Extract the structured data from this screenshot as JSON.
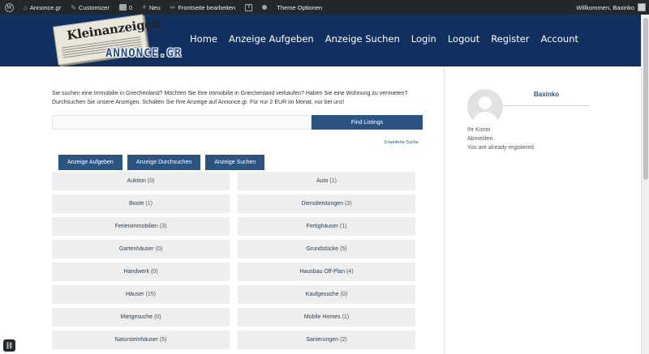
{
  "adminbar": {
    "site": "Annonce.gr",
    "customizer": "Customizer",
    "comments": "0",
    "new": "Neu",
    "edit_front": "Frontseite bearbeiten",
    "theme_options": "Theme Optionen",
    "welcome": "Willkommen, Baxinko"
  },
  "header": {
    "logo_title": "Kleinanzeigen",
    "logo_sub": "ANNONCE.GR",
    "nav": [
      "Home",
      "Anzeige Aufgeben",
      "Anzeige Suchen",
      "Login",
      "Logout",
      "Register",
      "Account"
    ]
  },
  "main": {
    "intro": "Sie suchen eine Immobilie in Griechenland? Möchten Sie Ihre Immobilie in Griechenland verkaufen? Haben Sie eine Wohnung zu vermieten? Durchsuchen Sie unsere Anzeigen. Schalten Sie Ihre Anzeige auf Annonce.gr. Für nur 2 EUR im Monat, nur bei uns!",
    "search_placeholder": "",
    "find_button": "Find Listings",
    "advanced": "Erweiterte Suche",
    "buttons": [
      "Anzeige Aufgeben",
      "Anzeige Durchsuchen",
      "Anzeige Suchen"
    ],
    "categories": [
      {
        "name": "Auktion",
        "count": "(0)"
      },
      {
        "name": "Auto",
        "count": "(1)"
      },
      {
        "name": "Boote",
        "count": "(1)"
      },
      {
        "name": "Dienstleistungen",
        "count": "(3)"
      },
      {
        "name": "Ferienimmobilien",
        "count": "(3)"
      },
      {
        "name": "Fertighäuser",
        "count": "(1)"
      },
      {
        "name": "Gartenhäuser",
        "count": "(0)"
      },
      {
        "name": "Grundstücke",
        "count": "(5)"
      },
      {
        "name": "Handwerk",
        "count": "(0)"
      },
      {
        "name": "Hausbau Off-Plan",
        "count": "(4)"
      },
      {
        "name": "Häuser",
        "count": "(15)"
      },
      {
        "name": "Kaufgesuche",
        "count": "(0)"
      },
      {
        "name": "Mietgesuche",
        "count": "(0)"
      },
      {
        "name": "Mobile Homes",
        "count": "(1)"
      },
      {
        "name": "Natursteinhäuser",
        "count": "(5)"
      },
      {
        "name": "Sanierungen",
        "count": "(2)"
      }
    ]
  },
  "sidebar": {
    "username": "Baxinko",
    "links": [
      "Ihr Konto",
      "Abmelden",
      "You are already registered"
    ]
  },
  "colors": {
    "header_bg": "#11305f",
    "button_bg": "#2c5483",
    "adminbar_bg": "#23282d"
  }
}
